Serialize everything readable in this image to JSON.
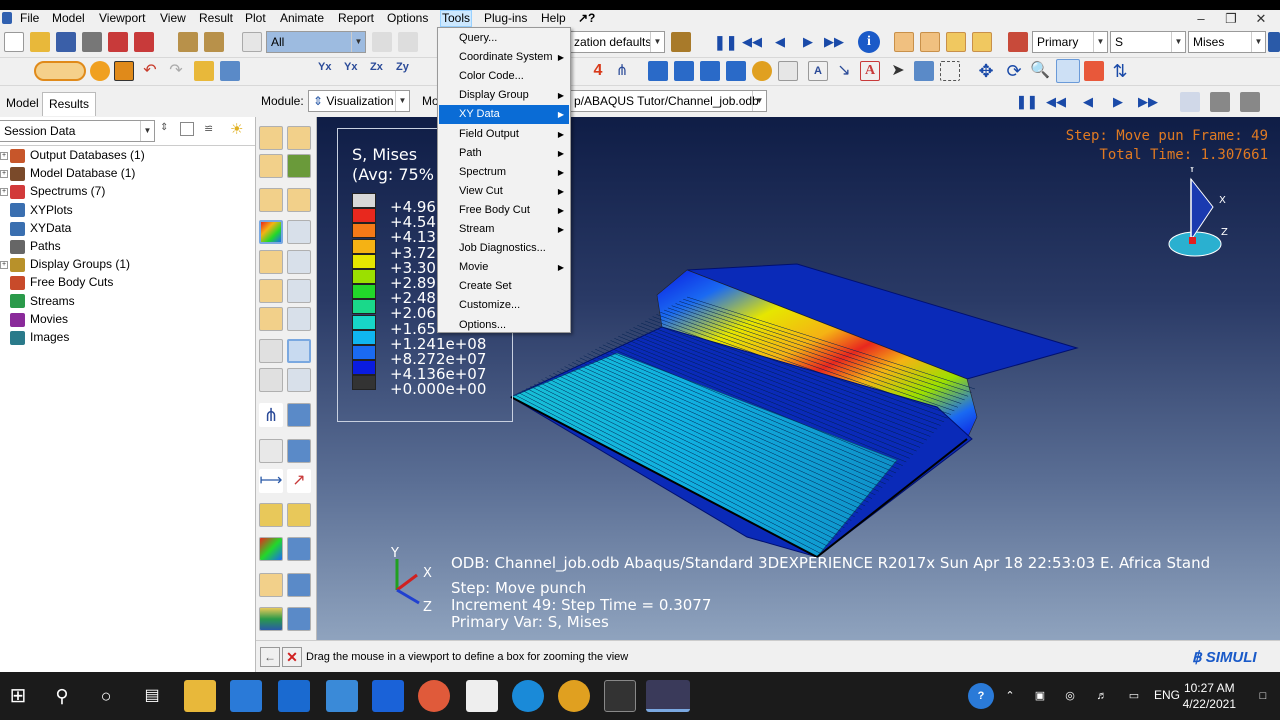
{
  "menubar": {
    "items": [
      "File",
      "Model",
      "Viewport",
      "View",
      "Result",
      "Plot",
      "Animate",
      "Report",
      "Options",
      "Tools",
      "Plug-ins",
      "Help"
    ],
    "help_pointer": "↗?"
  },
  "toolbar": {
    "selection_filter": "All",
    "render_style": "zation defaults",
    "step_indicator": "4",
    "field_primary": "Primary",
    "field_variable": "S",
    "field_invariant": "Mises"
  },
  "module": {
    "label": "Module:",
    "value": "Visualization",
    "model_label": "Mo",
    "odb_path": "p/ABAQUS Tutor/Channel_job.odb"
  },
  "left_panel": {
    "tabs": [
      "Model",
      "Results"
    ],
    "session_combo": "Session Data",
    "tree": [
      {
        "label": "Output Databases (1)",
        "expandable": true,
        "icon_color": "#c7562a"
      },
      {
        "label": "Model Database (1)",
        "expandable": true,
        "icon_color": "#7a4a2a"
      },
      {
        "label": "Spectrums (7)",
        "expandable": true,
        "icon_color": "#d23a3a"
      },
      {
        "label": "XYPlots",
        "expandable": false,
        "icon_color": "#3a6fb0"
      },
      {
        "label": "XYData",
        "expandable": false,
        "icon_color": "#3a6fb0"
      },
      {
        "label": "Paths",
        "expandable": false,
        "icon_color": "#666666"
      },
      {
        "label": "Display Groups (1)",
        "expandable": true,
        "icon_color": "#b8912a"
      },
      {
        "label": "Free Body Cuts",
        "expandable": false,
        "icon_color": "#c84a2a"
      },
      {
        "label": "Streams",
        "expandable": false,
        "icon_color": "#2a9a4a"
      },
      {
        "label": "Movies",
        "expandable": false,
        "icon_color": "#8a2a9a"
      },
      {
        "label": "Images",
        "expandable": false,
        "icon_color": "#2a7a8a"
      }
    ]
  },
  "tools_menu": {
    "items": [
      {
        "label": "Query...",
        "submenu": false
      },
      {
        "label": "Coordinate System",
        "submenu": true
      },
      {
        "label": "Color Code...",
        "submenu": false
      },
      {
        "label": "Display Group",
        "submenu": true
      },
      {
        "label": "XY Data",
        "submenu": true,
        "highlighted": true
      },
      {
        "label": "Field Output",
        "submenu": true
      },
      {
        "label": "Path",
        "submenu": true
      },
      {
        "label": "Spectrum",
        "submenu": true
      },
      {
        "label": "View Cut",
        "submenu": true
      },
      {
        "label": "Free Body Cut",
        "submenu": true
      },
      {
        "label": "Stream",
        "submenu": true
      },
      {
        "label": "Job Diagnostics...",
        "submenu": false
      },
      {
        "label": "Movie",
        "submenu": true
      },
      {
        "label": "Create Set",
        "submenu": false
      },
      {
        "label": "Customize...",
        "submenu": false
      },
      {
        "label": "Options...",
        "submenu": false
      }
    ]
  },
  "legend": {
    "title": "S, Mises",
    "subtitle": "(Avg: 75%",
    "values": [
      "+4.96",
      "+4.54",
      "+4.13",
      "+3.72",
      "+3.30",
      "+2.89",
      "+2.48",
      "+2.06",
      "+1.65",
      "+1.241e+08",
      "+8.272e+07",
      "+4.136e+07",
      "+0.000e+00"
    ],
    "colors": [
      "#d8d8d8",
      "#e8281e",
      "#f57a17",
      "#f5b214",
      "#e6e600",
      "#9be000",
      "#22d82a",
      "#1ad98a",
      "#17d6c8",
      "#10b6f0",
      "#1a6af2",
      "#0a1ce0",
      "#333333"
    ]
  },
  "viewport": {
    "step_line": "Step: Move pun Frame: 49",
    "time_line": "Total Time: 1.307661",
    "triad": {
      "y": "Y",
      "x": "X",
      "z": "Z"
    },
    "mini_triad": {
      "y": "Y",
      "x": "X",
      "z": "Z"
    },
    "odb_line": "ODB: Channel_job.odb     Abaqus/Standard 3DEXPERIENCE R2017x     Sun Apr 18 22:53:03 E. Africa Stand",
    "step_info": "Step: Move punch",
    "increment_info": "Increment      49: Step Time =    0.3077",
    "primary_var": "Primary Var: S, Mises"
  },
  "status": {
    "message": "Drag the mouse in a viewport to define a box for zooming the view",
    "brand": "SIMULI"
  },
  "taskbar": {
    "lang": "ENG",
    "time": "10:27 AM",
    "date": "4/22/2021"
  }
}
